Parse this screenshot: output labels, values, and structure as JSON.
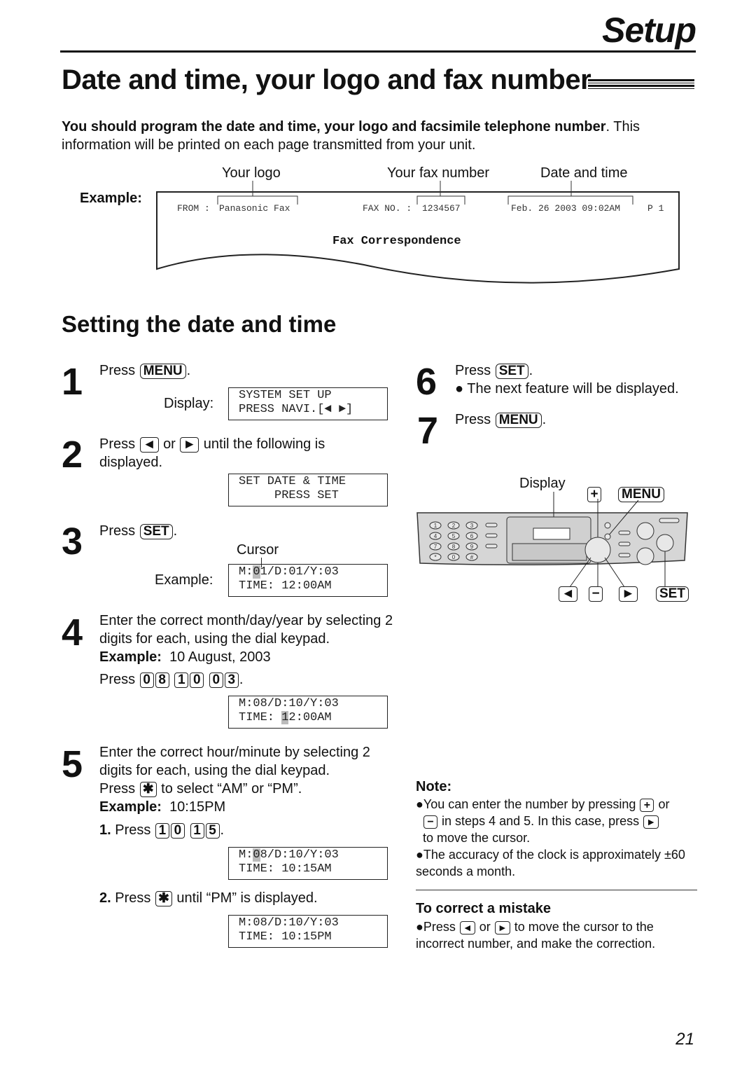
{
  "header": {
    "section": "Setup"
  },
  "title": "Date and time, your logo and fax number",
  "intro": {
    "bold": "You should program the date and time, your logo and facsimile telephone number",
    "rest": ". This information will be printed on each page transmitted from your unit."
  },
  "example": {
    "label": "Example:",
    "callouts": {
      "logo": "Your logo",
      "fax_number": "Your fax number",
      "date_time": "Date and time"
    },
    "fax_header": {
      "from_label": "FROM :",
      "from_value": "Panasonic Fax",
      "faxno_label": "FAX NO. :",
      "faxno_value": "1234567",
      "datetime": "Feb. 26 2003 09:02AM",
      "page": "P 1"
    },
    "body_title": "Fax Correspondence"
  },
  "section2": {
    "title": "Setting the date and time"
  },
  "steps": {
    "s1": {
      "num": "1",
      "press": "Press",
      "key": "MENU",
      "display_label": "Display:",
      "lcd1": "SYSTEM SET UP",
      "lcd2": "PRESS NAVI.[◄ ►]"
    },
    "s2": {
      "num": "2",
      "press": "Press",
      "or": "or",
      "text": "until the following is displayed.",
      "lcd1": "SET DATE & TIME",
      "lcd2": "     PRESS SET"
    },
    "s3": {
      "num": "3",
      "press": "Press",
      "key": "SET",
      "cursor_label": "Cursor",
      "example_label": "Example:",
      "lcd1_pre": "M:",
      "lcd1_cur": "0",
      "lcd1_post": "1/D:01/Y:03",
      "lcd2": "TIME: 12:00AM"
    },
    "s4": {
      "num": "4",
      "text": "Enter the correct month/day/year by selecting 2 digits for each, using the dial keypad.",
      "example_bold": "Example:",
      "example_text": "10 August, 2003",
      "press": "Press",
      "keys": [
        [
          "0",
          "8"
        ],
        [
          "1",
          "0"
        ],
        [
          "0",
          "3"
        ]
      ],
      "lcd1": "M:08/D:10/Y:03",
      "lcd2_pre": "TIME: ",
      "lcd2_cur": "1",
      "lcd2_post": "2:00AM"
    },
    "s5": {
      "num": "5",
      "text": "Enter the correct hour/minute by selecting 2 digits for each, using the dial keypad.",
      "press": "Press",
      "star_text": "to select “AM” or “PM”.",
      "example_bold": "Example:",
      "example_text": "10:15PM",
      "sub1_num": "1.",
      "sub1_press": "Press",
      "sub1_keys": [
        [
          "1",
          "0"
        ],
        [
          "1",
          "5"
        ]
      ],
      "lcd_a1_pre": "M:",
      "lcd_a1_cur": "0",
      "lcd_a1_post": "8/D:10/Y:03",
      "lcd_a2": "TIME: 10:15AM",
      "sub2_num": "2.",
      "sub2_press": "Press",
      "sub2_text": "until “PM” is displayed.",
      "lcd_b1": "M:08/D:10/Y:03",
      "lcd_b2": "TIME: 10:15PM"
    },
    "s6": {
      "num": "6",
      "press": "Press",
      "key": "SET",
      "bullet": "The next feature will be displayed."
    },
    "s7": {
      "num": "7",
      "press": "Press",
      "key": "MENU"
    }
  },
  "panel": {
    "display_label": "Display",
    "plus_key": "+",
    "menu_key": "MENU",
    "minus_key": "−",
    "set_key": "SET",
    "keypad": [
      "1",
      "2",
      "3",
      "4",
      "5",
      "6",
      "7",
      "8",
      "9",
      "*",
      "0",
      "#"
    ]
  },
  "note": {
    "title": "Note:",
    "b1_a": "You can enter the number by pressing",
    "b1_or": "or",
    "b1_b": "in steps 4 and 5. In this case, press",
    "b1_c": "to move the cursor.",
    "b2": "The accuracy of the clock is approximately ±60 seconds a month."
  },
  "correct": {
    "title": "To correct a mistake",
    "press": "Press",
    "or": "or",
    "text": "to move the cursor to the incorrect number, and make the correction."
  },
  "page_number": "21"
}
